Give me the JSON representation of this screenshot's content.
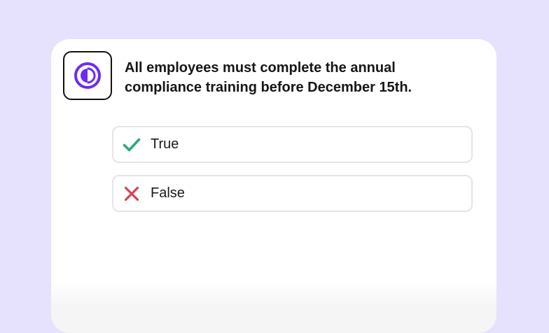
{
  "app": {
    "icon": "contrast-circle-icon",
    "accent_color": "#6c2bf5"
  },
  "question": {
    "text": "All employees must complete the annual compliance training before December 15th."
  },
  "options": [
    {
      "label": "True",
      "icon": "check-icon",
      "color": "#2ea879"
    },
    {
      "label": "False",
      "icon": "close-icon",
      "color": "#d9414f"
    }
  ]
}
